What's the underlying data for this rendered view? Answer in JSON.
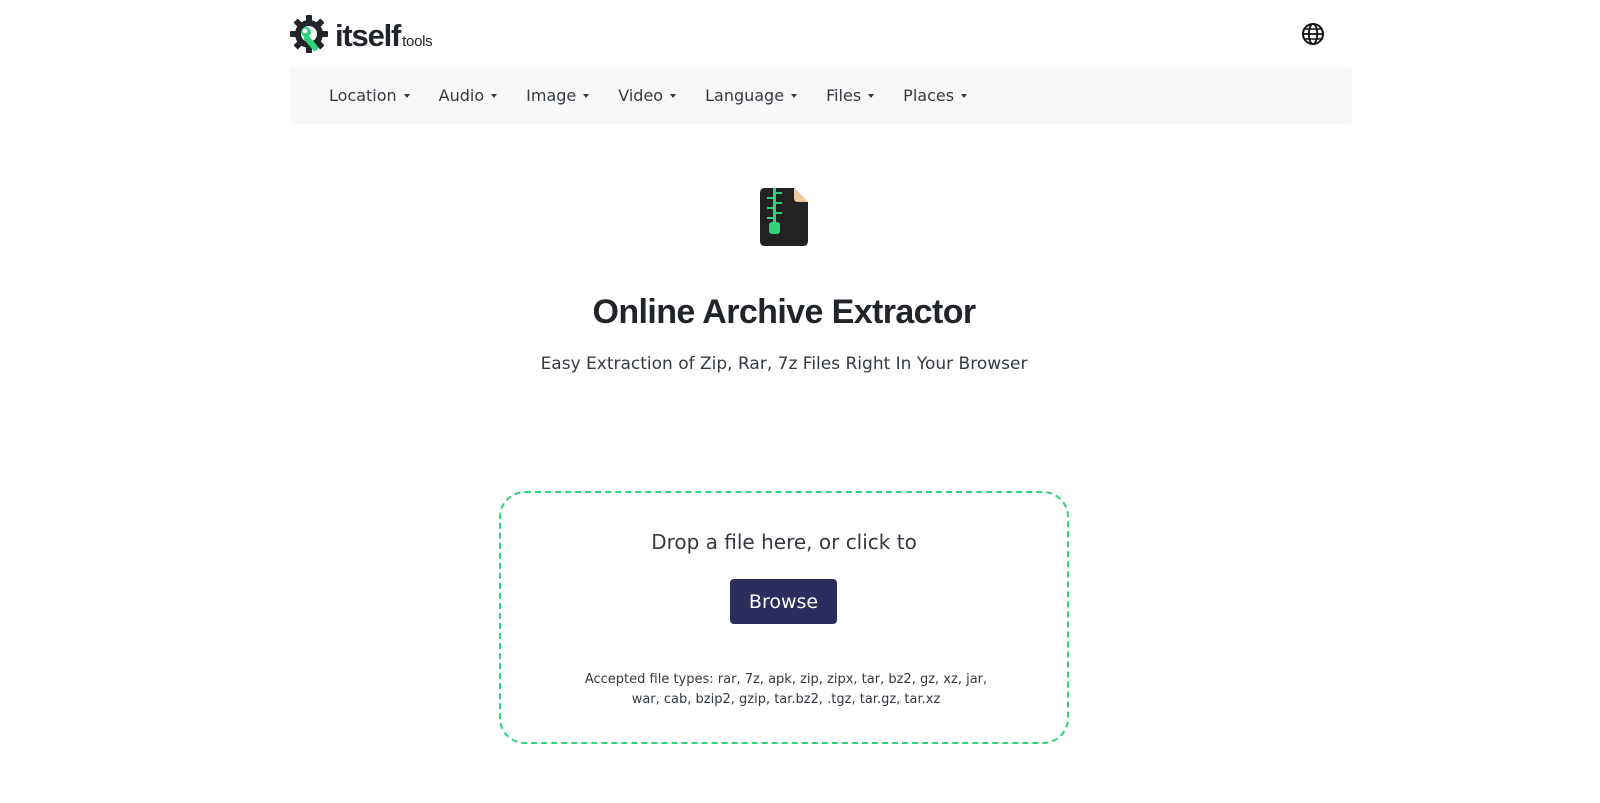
{
  "header": {
    "brand": "itself",
    "brand_sub": "tools",
    "logo_icon": "gear-wrench-icon",
    "language_icon": "globe-icon"
  },
  "nav": {
    "items": [
      {
        "label": "Location"
      },
      {
        "label": "Audio"
      },
      {
        "label": "Image"
      },
      {
        "label": "Video"
      },
      {
        "label": "Language"
      },
      {
        "label": "Files"
      },
      {
        "label": "Places"
      }
    ]
  },
  "hero": {
    "icon": "zip-archive-icon",
    "title": "Online Archive Extractor",
    "subtitle": "Easy Extraction of Zip, Rar, 7z Files Right In Your Browser"
  },
  "dropzone": {
    "prompt": "Drop a file here, or click to",
    "browse_label": "Browse",
    "accepted_types": "Accepted file types: rar, 7z, apk, zip, zipx, tar, bz2, gz, xz, jar, war, cab, bzip2, gzip, tar.bz2, .tgz, tar.gz, tar.xz"
  },
  "colors": {
    "accent_green": "#2ed47a",
    "button_navy": "#2b2d5c",
    "nav_background": "#f8f8f8"
  }
}
